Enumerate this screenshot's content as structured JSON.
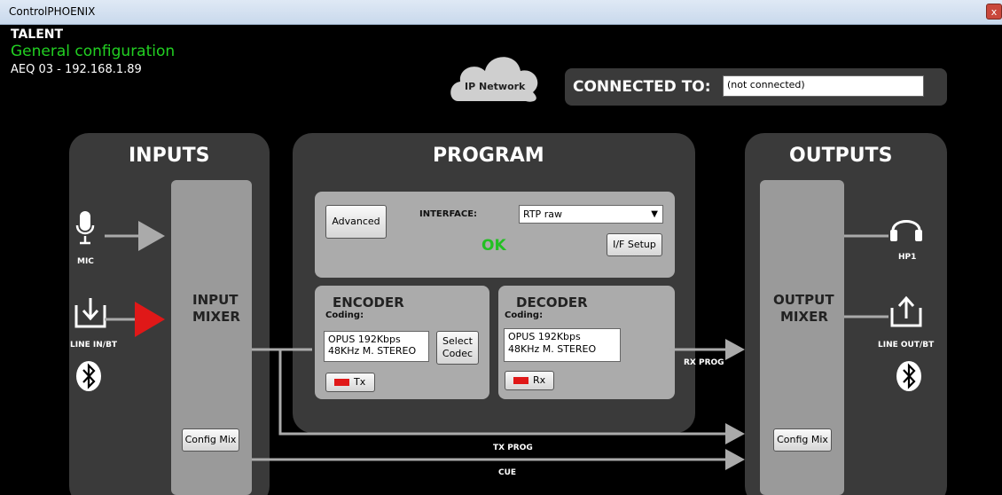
{
  "window": {
    "title": "ControlPHOENIX",
    "close_label": "x"
  },
  "header": {
    "device": "TALENT",
    "subtitle": "General configuration",
    "address": "AEQ 03  -  192.168.1.89",
    "network_label": "IP Network",
    "connected_label": "CONNECTED TO:",
    "connected_value": "(not connected)"
  },
  "inputs": {
    "title": "INPUTS",
    "mixer_label_1": "INPUT",
    "mixer_label_2": "MIXER",
    "mic_label": "MIC",
    "line_label": "LINE IN/BT",
    "config_mix": "Config Mix"
  },
  "program": {
    "title": "PROGRAM",
    "advanced": "Advanced",
    "interface_label": "INTERFACE:",
    "interface_value": "RTP raw",
    "status": "OK",
    "if_setup": "I/F Setup",
    "encoder": {
      "title": "ENCODER",
      "coding": "Coding:",
      "line1": "OPUS 192Kbps",
      "line2": "48KHz M. STEREO",
      "select_1": "Select",
      "select_2": "Codec",
      "tx": "Tx"
    },
    "decoder": {
      "title": "DECODER",
      "coding": "Coding:",
      "line1": "OPUS 192Kbps",
      "line2": "48KHz M. STEREO",
      "rx": "Rx"
    }
  },
  "outputs": {
    "title": "OUTPUTS",
    "mixer_label_1": "OUTPUT",
    "mixer_label_2": "MIXER",
    "hp_label": "HP1",
    "line_label": "LINE OUT/BT",
    "config_mix": "Config Mix"
  },
  "routing": {
    "rx_prog": "RX PROG",
    "tx_prog": "TX PROG",
    "cue": "CUE"
  },
  "colors": {
    "status_ok": "#22c022",
    "subtitle": "#22d022",
    "red_indicator": "#e01818"
  }
}
